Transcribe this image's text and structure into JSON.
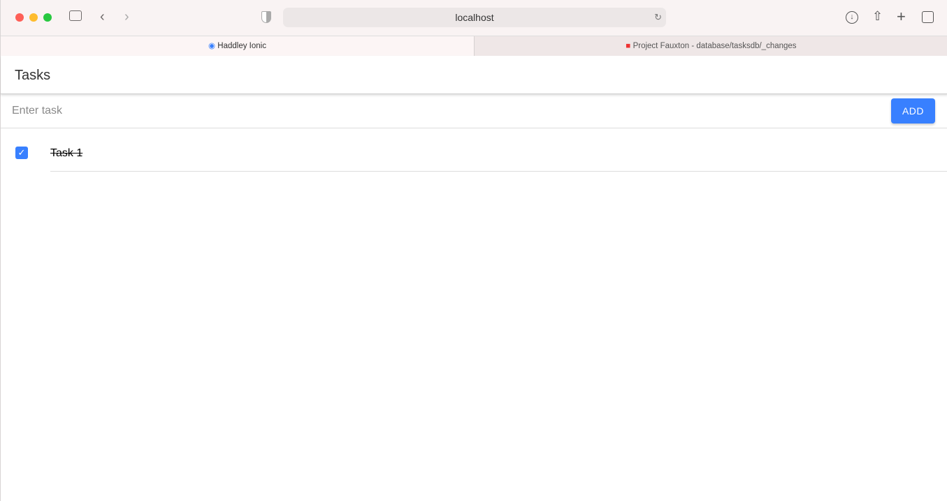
{
  "browser": {
    "url": "localhost",
    "tabs": [
      {
        "label": "Haddley Ionic",
        "active": true
      },
      {
        "label": "Project Fauxton - database/tasksdb/_changes",
        "active": false
      }
    ]
  },
  "app": {
    "title": "Tasks",
    "input_placeholder": "Enter task",
    "input_value": "",
    "add_label": "ADD",
    "tasks": [
      {
        "label": "Task 1",
        "done": true
      }
    ]
  },
  "colors": {
    "accent": "#3880ff"
  }
}
